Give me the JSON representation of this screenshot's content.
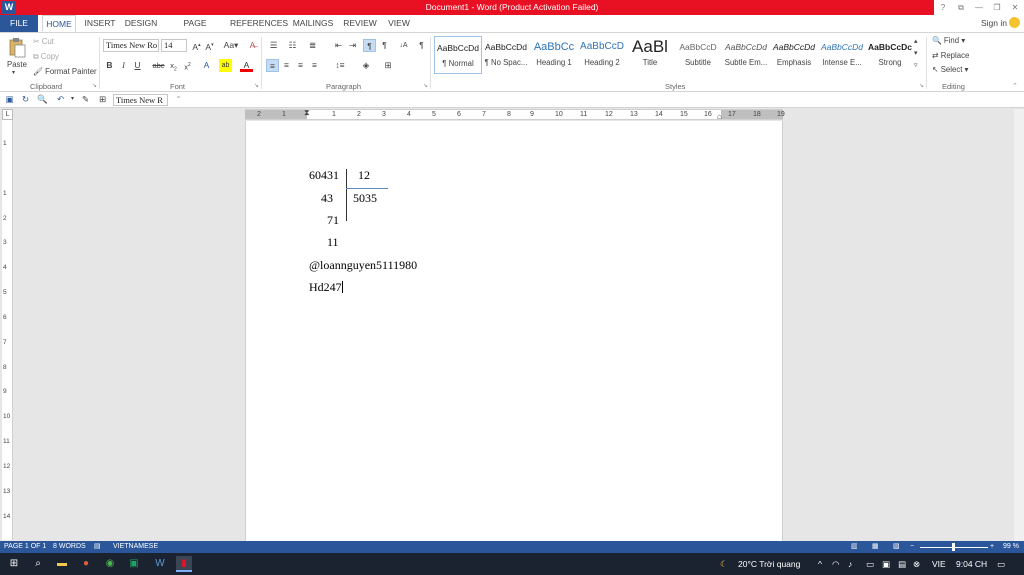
{
  "window": {
    "title": "Document1 -  Word (Product Activation Failed)",
    "app_icon": "W",
    "controls": [
      "?",
      "⧉",
      "—",
      "❐",
      "✕"
    ]
  },
  "tabs": [
    "FILE",
    "HOME",
    "INSERT",
    "DESIGN",
    "PAGE LAYOUT",
    "REFERENCES",
    "MAILINGS",
    "REVIEW",
    "VIEW"
  ],
  "signin": "Sign in",
  "ribbon": {
    "clipboard": {
      "paste": "Paste",
      "cut": "Cut",
      "copy": "Copy",
      "format_painter": "Format Painter",
      "label": "Clipboard"
    },
    "font": {
      "name": "Times New Ro",
      "size": "14",
      "label": "Font"
    },
    "paragraph": {
      "label": "Paragraph"
    },
    "styles": {
      "label": "Styles",
      "items": [
        {
          "preview": "AaBbCcDd",
          "name": "¶ Normal"
        },
        {
          "preview": "AaBbCcDd",
          "name": "¶ No Spac..."
        },
        {
          "preview": "AaBbCc",
          "name": "Heading 1"
        },
        {
          "preview": "AaBbCcD",
          "name": "Heading 2"
        },
        {
          "preview": "AaBl",
          "name": "Title"
        },
        {
          "preview": "AaBbCcD",
          "name": "Subtitle"
        },
        {
          "preview": "AaBbCcDd",
          "name": "Subtle Em..."
        },
        {
          "preview": "AaBbCcDd",
          "name": "Emphasis"
        },
        {
          "preview": "AaBbCcDd",
          "name": "Intense E..."
        },
        {
          "preview": "AaBbCcDc",
          "name": "Strong"
        }
      ]
    },
    "editing": {
      "find": "Find",
      "replace": "Replace",
      "select": "Select",
      "label": "Editing"
    }
  },
  "qat": {
    "font_box": "Times New R"
  },
  "ruler_h": [
    "2",
    "1",
    "1",
    "2",
    "3",
    "4",
    "5",
    "6",
    "7",
    "8",
    "9",
    "10",
    "11",
    "12",
    "13",
    "14",
    "15",
    "16",
    "17",
    "18",
    "19"
  ],
  "ruler_v": [
    "1",
    "1",
    "2",
    "3",
    "4",
    "5",
    "6",
    "7",
    "8",
    "9",
    "10",
    "11",
    "12",
    "13",
    "14"
  ],
  "document": {
    "dividend": "60431",
    "divisor": "12",
    "step1": "43",
    "quotient": "5035",
    "step2": "71",
    "remainder": "11",
    "line_handle": "@loannguyen5111980",
    "line_last": "Hd247"
  },
  "status": {
    "page": "PAGE 1 OF 1",
    "words": "8 WORDS",
    "language": "VIETNAMESE",
    "zoom": "99 %"
  },
  "taskbar": {
    "weather": "20°C  Trời quang",
    "lang": "VIE",
    "time": "9:04 CH"
  }
}
